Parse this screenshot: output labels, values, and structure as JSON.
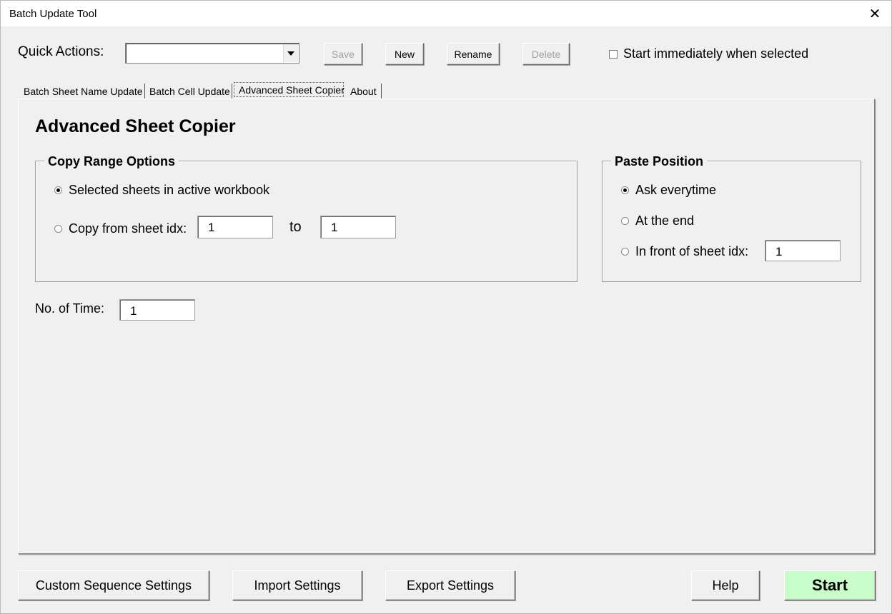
{
  "window": {
    "title": "Batch Update Tool"
  },
  "quick_actions": {
    "label": "Quick Actions:",
    "combo_value": "",
    "buttons": {
      "save": "Save",
      "new": "New",
      "rename": "Rename",
      "delete": "Delete"
    },
    "start_immediately_label": "Start immediately when selected",
    "start_immediately_checked": false
  },
  "tabs": [
    {
      "label": "Batch Sheet Name Update",
      "active": false
    },
    {
      "label": "Batch Cell Update",
      "active": false
    },
    {
      "label": "Advanced Sheet Copier",
      "active": true
    },
    {
      "label": "About",
      "active": false
    }
  ],
  "page": {
    "title": "Advanced Sheet Copier",
    "copy_range": {
      "label": "Copy Range Options",
      "option_selected": "Selected sheets in active workbook",
      "option_range": "Copy from sheet idx:",
      "from_value": "1",
      "to_label": "to",
      "to_value": "1"
    },
    "paste_position": {
      "label": "Paste Position",
      "ask": "Ask everytime",
      "end": "At the end",
      "front": "In front of sheet idx:",
      "front_value": "1"
    },
    "no_of_time": {
      "label": "No. of Time:",
      "value": "1"
    }
  },
  "footer": {
    "custom_sequence": "Custom Sequence Settings",
    "import": "Import Settings",
    "export": "Export Settings",
    "help": "Help",
    "start": "Start",
    "start_color": "#c8fcc8"
  }
}
